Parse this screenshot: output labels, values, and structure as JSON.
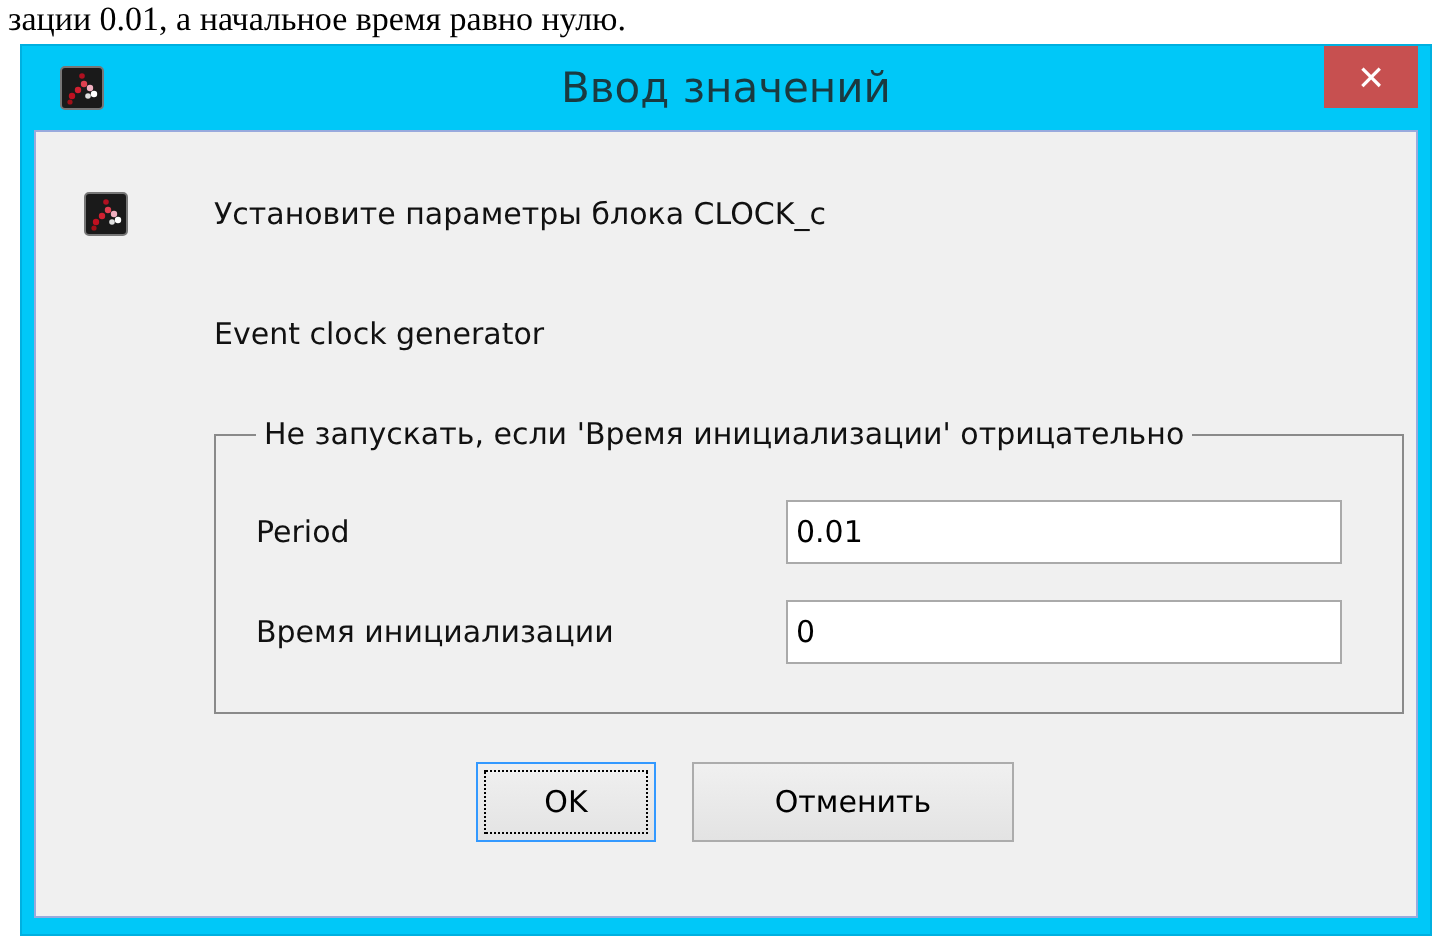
{
  "document_text": "зации 0.01, а начальное время равно нулю.",
  "window": {
    "title": "Ввод значений",
    "close": "×"
  },
  "message": "Установите параметры блока CLOCK_c",
  "description": "Event clock generator",
  "group": {
    "title": "Не запускать, если 'Время инициализации' отрицательно",
    "fields": [
      {
        "label": "Period",
        "value": "0.01"
      },
      {
        "label": "Время инициализации",
        "value": "0"
      }
    ]
  },
  "buttons": [
    {
      "label": "OK",
      "focused": true
    },
    {
      "label": "Отменить",
      "focused": false
    }
  ]
}
